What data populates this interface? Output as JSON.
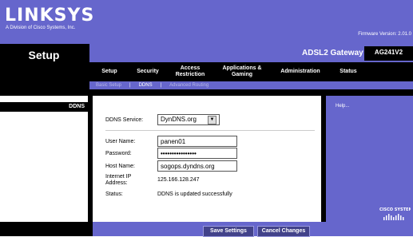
{
  "brand": {
    "logo": "LINKSYS",
    "tagline": "A Division of Cisco Systems, Inc.",
    "firmware": "Firmware Version: 2.01.0"
  },
  "page": {
    "section_title": "Setup",
    "gateway": "ADSL2 Gateway",
    "model": "AG241V2"
  },
  "tabs": [
    {
      "label": "Setup"
    },
    {
      "label": "Security"
    },
    {
      "label": "Access Restriction"
    },
    {
      "label": "Applications & Gaming"
    },
    {
      "label": "Administration"
    },
    {
      "label": "Status"
    }
  ],
  "subnav": [
    {
      "label": "Basic Setup"
    },
    {
      "label": "|"
    },
    {
      "label": "DDNS"
    },
    {
      "label": "|"
    },
    {
      "label": "Advanced Routing"
    }
  ],
  "left": {
    "ddns_label": "DDNS"
  },
  "form": {
    "service_label": "DDNS Service:",
    "service_value": "DynDNS.org",
    "username_label": "User Name:",
    "username_value": "panen01",
    "password_label": "Password:",
    "password_value": "••••••••••••••••",
    "host_label": "Host Name:",
    "host_value": "sogops.dyndns.org",
    "ip_label": "Internet IP Address:",
    "ip_value": "125.166.128.247",
    "status_label": "Status:",
    "status_value": "DDNS is updated successfully"
  },
  "help": {
    "label": "Help..."
  },
  "footer": {
    "save": "Save Settings",
    "cancel": "Cancel Changes"
  },
  "colors": {
    "brand_purple": "#6666cc",
    "black": "#000000"
  },
  "cisco": {
    "label": "Cisco Systems"
  }
}
